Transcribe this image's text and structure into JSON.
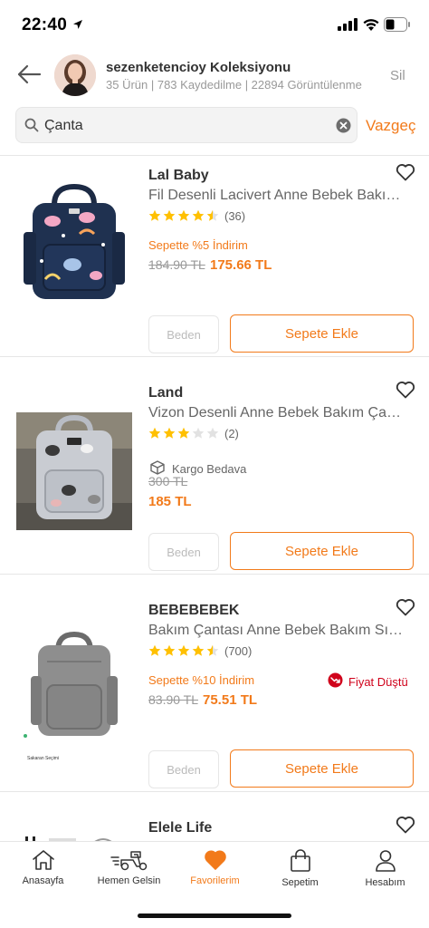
{
  "status_bar": {
    "time": "22:40"
  },
  "header": {
    "title": "sezenketencioy Koleksiyonu",
    "stats": "35 Ürün | 783 Kaydedilme | 22894 Görüntülenme",
    "delete_label": "Sil"
  },
  "search": {
    "value": "Çanta",
    "cancel_label": "Vazgeç"
  },
  "products": [
    {
      "brand": "Lal Baby",
      "name": "Fil Desenli Lacivert Anne Bebek Bakım Çantası",
      "rating": 4.5,
      "rating_count": "(36)",
      "promo": "Sepette %5 İndirim",
      "old_price": "184.90 TL",
      "new_price": "175.66 TL",
      "size_label": "Beden",
      "add_label": "Sepete Ekle"
    },
    {
      "brand": "Land",
      "name": "Vizon Desenli Anne Bebek Bakım Çantası",
      "rating": 3,
      "rating_count": "(2)",
      "cargo": "Kargo Bedava",
      "old_price": "300 TL",
      "new_price": "185 TL",
      "size_label": "Beden",
      "add_label": "Sepete Ekle"
    },
    {
      "brand": "BEBEBEBEK",
      "name": "Bakım Çantası Anne Bebek Bakım Sırt Çantası",
      "rating": 4.5,
      "rating_count": "(700)",
      "promo": "Sepette %10 İndirim",
      "price_drop": "Fiyat Düştü",
      "old_price": "83.90 TL",
      "new_price": "75.51 TL",
      "size_label": "Beden",
      "add_label": "Sepete Ekle",
      "image_caption": "Sakaran Seçimi"
    },
    {
      "brand": "Elele Life"
    }
  ],
  "bottom_nav": [
    {
      "label": "Anasayfa",
      "icon": "home-icon"
    },
    {
      "label": "Hemen Gelsin",
      "icon": "scooter-icon"
    },
    {
      "label": "Favorilerim",
      "icon": "heart-icon",
      "active": true
    },
    {
      "label": "Sepetim",
      "icon": "cart-icon"
    },
    {
      "label": "Hesabım",
      "icon": "user-icon"
    }
  ],
  "colors": {
    "accent": "#f27a1a",
    "star": "#ffc000",
    "price_drop": "#d0021b"
  }
}
